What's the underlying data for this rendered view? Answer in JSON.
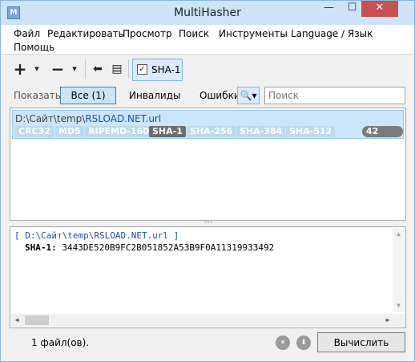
{
  "window": {
    "title": "MultiHasher",
    "app_icon": "multihasher-app-icon",
    "min_glyph": "—",
    "max_glyph": "☐",
    "close_glyph": "✕"
  },
  "menu": {
    "items": [
      "Файл",
      "Редактировать",
      "Просмотр",
      "Поиск",
      "Инструменты",
      "Language / Язык",
      "Помощь"
    ]
  },
  "toolbar": {
    "add_glyph": "+",
    "remove_glyph": "−",
    "dropdown_glyph": "▾",
    "undo_glyph": "⬅",
    "clear_glyph": "▤",
    "sha1_checked": "✓",
    "sha1_label": "SHA-1"
  },
  "filter": {
    "show_label": "Показать",
    "all_label": "Все (1)",
    "invalid_label": "Инвалиды",
    "errors_label": "Ошибки",
    "search_dropdown_glyph": "🔍▾",
    "search_placeholder": "Поиск"
  },
  "file": {
    "dir": "D:\\Сайт\\temp\\",
    "name": "RSLOAD.NET.url",
    "algorithms": [
      "CRC32",
      "MD5",
      "RIPEMD-160",
      "SHA-1",
      "SHA-256",
      "SHA-384",
      "SHA-512"
    ],
    "active_algorithm": "SHA-1",
    "size": "42 байт"
  },
  "details": {
    "path_line": "[ D:\\Сайт\\temp\\RSLOAD.NET.url ]",
    "hash_label": "SHA-1:",
    "hash_value": "3443DE520B9FC2B051852A53B9F0A11319933492"
  },
  "status": {
    "count": "1 файл(ов).",
    "pause_glyph": "⏸",
    "stop_glyph": "⬇",
    "compute_label": "Вычислить"
  },
  "colors": {
    "titlebar": "#cde3f7",
    "selection": "#cbe6fb",
    "accent": "#3c7fb1",
    "link_text": "#1a4f9c",
    "close_button": "#c75050"
  }
}
